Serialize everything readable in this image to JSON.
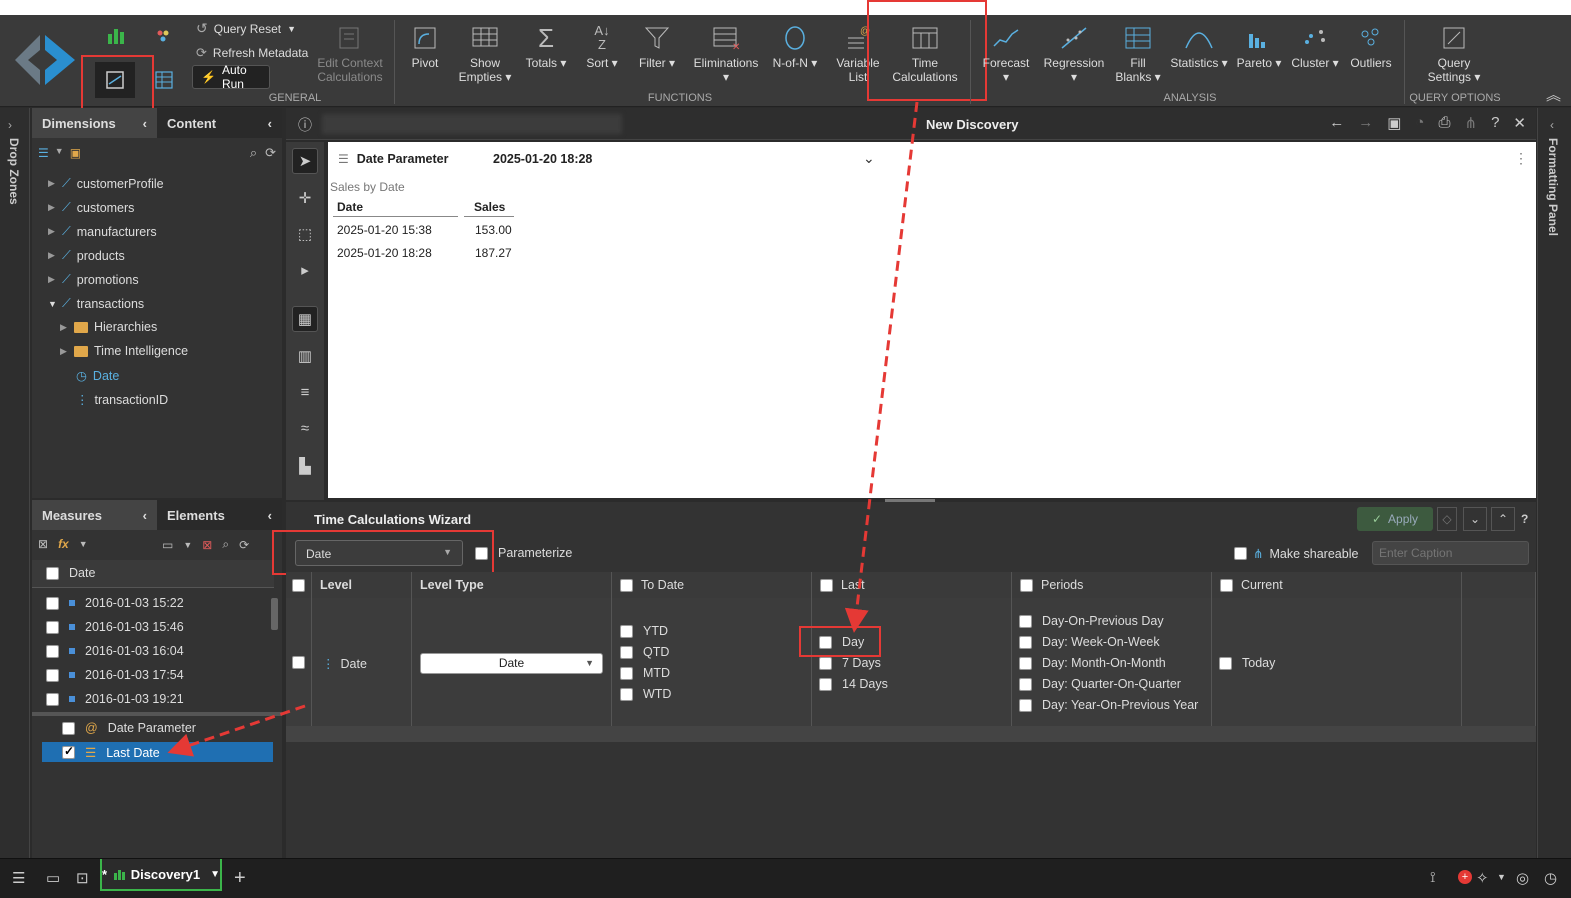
{
  "ribbon": {
    "query_reset": "Query Reset",
    "refresh_metadata": "Refresh Metadata",
    "auto_run": "Auto Run",
    "edit_context": "Edit Context Calculations",
    "general": "GENERAL",
    "functions": "FUNCTIONS",
    "analysis": "ANALYSIS",
    "query_options": "QUERY OPTIONS",
    "pivot": "Pivot",
    "show_empties": "Show Empties ▾",
    "totals": "Totals ▾",
    "sort": "Sort ▾",
    "filter": "Filter ▾",
    "eliminations": "Eliminations ▾",
    "n_of_n": "N-of-N ▾",
    "variable_list": "Variable List",
    "time_calculations": "Time Calculations",
    "forecast": "Forecast ▾",
    "regression": "Regression ▾",
    "fill_blanks": "Fill Blanks ▾",
    "statistics": "Statistics ▾",
    "pareto": "Pareto ▾",
    "cluster": "Cluster ▾",
    "outliers": "Outliers",
    "query_settings": "Query Settings ▾"
  },
  "side": {
    "drop_zones": "Drop Zones",
    "formatting_panel": "Formatting Panel"
  },
  "dimensions": {
    "tab1": "Dimensions",
    "tab2": "Content",
    "items": [
      "customerProfile",
      "customers",
      "manufacturers",
      "products",
      "promotions",
      "transactions",
      "Hierarchies",
      "Time Intelligence",
      "Date",
      "transactionID"
    ]
  },
  "measures": {
    "tab1": "Measures",
    "tab2": "Elements",
    "header": "Date",
    "rows": [
      "2016-01-03 15:22",
      "2016-01-03 15:46",
      "2016-01-03 16:04",
      "2016-01-03 17:54",
      "2016-01-03 19:21"
    ],
    "date_parameter": "Date Parameter",
    "last_date": "Last Date"
  },
  "discovery": {
    "title": "New Discovery",
    "param_label": "Date Parameter",
    "param_value": "2025-01-20 18:28",
    "table_caption": "Sales by Date",
    "col_date": "Date",
    "col_sales": "Sales",
    "rows": [
      {
        "date": "2025-01-20 15:38",
        "sales": "153.00"
      },
      {
        "date": "2025-01-20 18:28",
        "sales": "187.27"
      }
    ]
  },
  "wizard": {
    "title": "Time Calculations Wizard",
    "apply": "Apply",
    "dropdown_value": "Date",
    "parameterize": "Parameterize",
    "make_shareable": "Make shareable",
    "caption_placeholder": "Enter Caption",
    "headers": {
      "level": "Level",
      "level_type": "Level Type",
      "to_date": "To Date",
      "last": "Last",
      "periods": "Periods",
      "current": "Current"
    },
    "row_level": "Date",
    "row_level_type": "Date",
    "to_date_opts": [
      "YTD",
      "QTD",
      "MTD",
      "WTD"
    ],
    "last_opts": [
      "Day",
      "7 Days",
      "14 Days"
    ],
    "periods_opts": [
      "Day-On-Previous Day",
      "Day: Week-On-Week",
      "Day: Month-On-Month",
      "Day: Quarter-On-Quarter",
      "Day: Year-On-Previous Year"
    ],
    "current_opts": [
      "Today"
    ]
  },
  "bottom": {
    "doc_tab": "Discovery1",
    "doc_prefix": "*"
  },
  "colors": {
    "accent_green": "#3bb54a",
    "highlight_red": "#e53935",
    "selected_blue": "#1f6fb2"
  }
}
